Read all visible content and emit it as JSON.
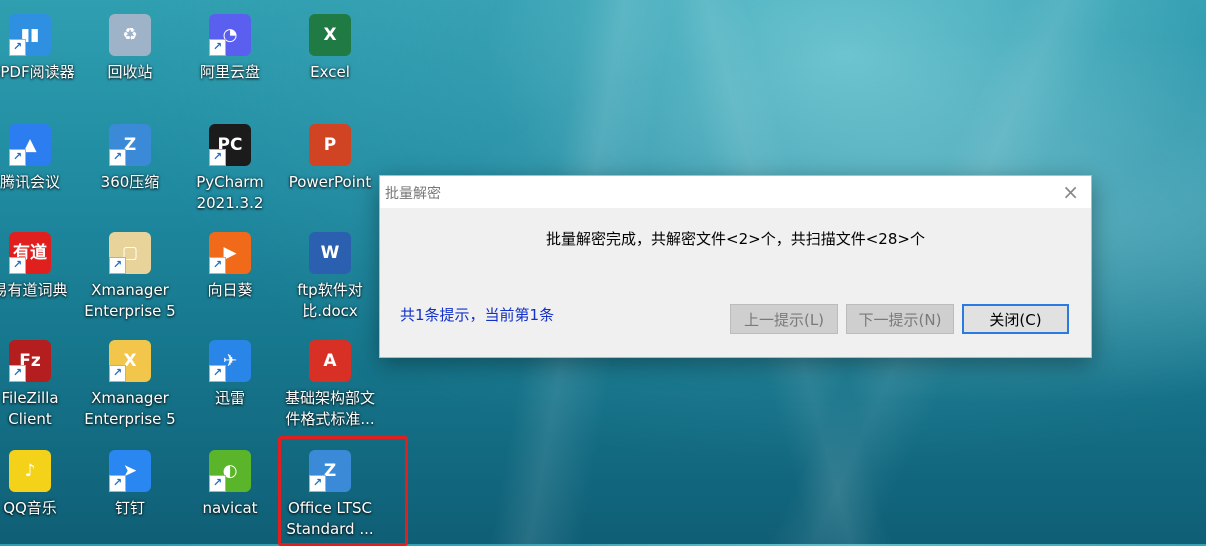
{
  "desktop": {
    "icons": [
      {
        "label": "书PDF阅读器",
        "icon": "book-reader-icon",
        "color": "#2f8fe0",
        "glyph": "▮▮"
      },
      {
        "label": "回收站",
        "icon": "recycle-bin-icon",
        "color": "#9fb3c8",
        "glyph": "♻"
      },
      {
        "label": "阿里云盘",
        "icon": "aliyun-drive-icon",
        "color": "#5b5ff0",
        "glyph": "◔"
      },
      {
        "label": "Excel",
        "icon": "excel-icon",
        "color": "#1f7a44",
        "glyph": "X"
      },
      {
        "label": "腾讯会议",
        "icon": "tencent-meeting-icon",
        "color": "#2c7ef0",
        "glyph": "▲"
      },
      {
        "label": "360压缩",
        "icon": "360-zip-icon",
        "color": "#3b8ad8",
        "glyph": "Z"
      },
      {
        "label": "PyCharm 2021.3.2",
        "icon": "pycharm-icon",
        "color": "#1b1b1b",
        "glyph": "PC"
      },
      {
        "label": "PowerPoint",
        "icon": "powerpoint-icon",
        "color": "#d04423",
        "glyph": "P"
      },
      {
        "label": "易有道词典",
        "icon": "youdao-dict-icon",
        "color": "#e0201f",
        "glyph": "有道"
      },
      {
        "label": "Xmanager Enterprise 5",
        "icon": "xmanager-folder-icon",
        "color": "#e8d49a",
        "glyph": "▢"
      },
      {
        "label": "向日葵",
        "icon": "sunflower-remote-icon",
        "color": "#f06a1a",
        "glyph": "▶"
      },
      {
        "label": "ftp软件对比.docx",
        "icon": "word-doc-icon",
        "color": "#2b5faf",
        "glyph": "W"
      },
      {
        "label": "FileZilla Client",
        "icon": "filezilla-icon",
        "color": "#b41e1e",
        "glyph": "Fz"
      },
      {
        "label": "Xmanager Enterprise 5",
        "icon": "xmanager-icon",
        "color": "#f2c64a",
        "glyph": "X"
      },
      {
        "label": "迅雷",
        "icon": "xunlei-icon",
        "color": "#2a85e8",
        "glyph": "✈"
      },
      {
        "label": "基础架构部文件格式标准...",
        "icon": "pdf-icon",
        "color": "#d93025",
        "glyph": "A"
      },
      {
        "label": "QQ音乐",
        "icon": "qq-music-icon",
        "color": "#f5d21a",
        "glyph": "♪"
      },
      {
        "label": "钉钉",
        "icon": "dingtalk-icon",
        "color": "#2a86f0",
        "glyph": "➤"
      },
      {
        "label": "navicat",
        "icon": "navicat-icon",
        "color": "#5bb52b",
        "glyph": "◐"
      },
      {
        "label": "Office LTSC Standard ...",
        "icon": "360-zip-archive-icon",
        "color": "#3b8ad8",
        "glyph": "Z"
      }
    ]
  },
  "dialog": {
    "title": "批量解密",
    "close_icon": "×",
    "message": "批量解密完成，共解密文件<2>个，共扫描文件<28>个",
    "hint": "共1条提示，当前第1条",
    "prev_label": "上一提示(L)",
    "next_label": "下一提示(N)",
    "close_label": "关闭(C)"
  }
}
